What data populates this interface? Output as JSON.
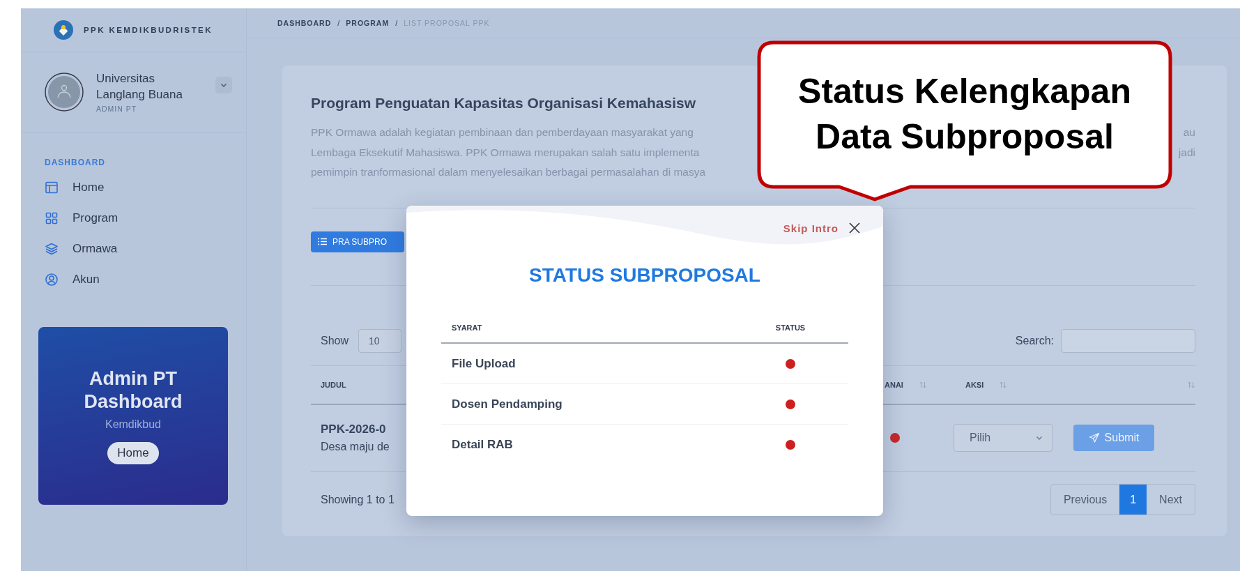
{
  "sidebar": {
    "brand": "PPK KEMDIKBUDRISTEK",
    "profile": {
      "name": "Universitas Langlang Buana",
      "role": "ADMIN PT"
    },
    "section_label": "DASHBOARD",
    "items": [
      {
        "label": "Home"
      },
      {
        "label": "Program"
      },
      {
        "label": "Ormawa"
      },
      {
        "label": "Akun"
      }
    ],
    "card": {
      "title": "Admin PT Dashboard",
      "subtitle": "Kemdikbud",
      "button": "Home"
    }
  },
  "breadcrumb": {
    "separator": "/",
    "items": [
      "DASHBOARD",
      "PROGRAM",
      "LIST PROPOSAL PPK"
    ]
  },
  "program": {
    "title": "Program Penguatan Kapasitas Organisasi Kemahasisw",
    "description": [
      {
        "left": "PPK Ormawa adalah kegiatan pembinaan dan pemberdayaan masyarakat yang",
        "right": "au"
      },
      {
        "left": "Lembaga Eksekutif Mahasiswa. PPK Ormawa merupakan salah satu implementa",
        "right": "jadi"
      },
      {
        "left": "pemimpin tranformasional dalam menyelesaikan berbagai permasalahan di masya"
      }
    ]
  },
  "pra_button": "PRA SUBPRO",
  "table_controls": {
    "show_label": "Show",
    "page_size": "10",
    "search_label": "Search:"
  },
  "table": {
    "columns": [
      {
        "label": "JUDUL",
        "sortable": false
      },
      {
        "label": "ANAI",
        "sortable": true
      },
      {
        "label": "AKSI",
        "sortable": true
      },
      {
        "sortable": true
      }
    ],
    "rows": [
      {
        "title": "PPK-2026-0",
        "subtitle": "Desa maju de",
        "color": "#c62828",
        "action": "Pilih",
        "submit": "Submit"
      }
    ]
  },
  "footer": {
    "info": "Showing 1 to 1",
    "previous": "Previous",
    "pages": [
      {
        "label": "1",
        "selected": true
      }
    ],
    "next": "Next"
  },
  "modal": {
    "skip": "Skip Intro",
    "title": "STATUS SUBPROPOSAL",
    "columns": [
      "SYARAT",
      "STATUS"
    ],
    "rows": [
      {
        "label": "File Upload",
        "color": "#cc1f1f"
      },
      {
        "label": "Dosen Pendamping",
        "color": "#cc1f1f"
      },
      {
        "label": "Detail RAB",
        "color": "#cc1f1f"
      }
    ]
  },
  "callout": {
    "text": "Status Kelengkapan Data Subproposal"
  }
}
